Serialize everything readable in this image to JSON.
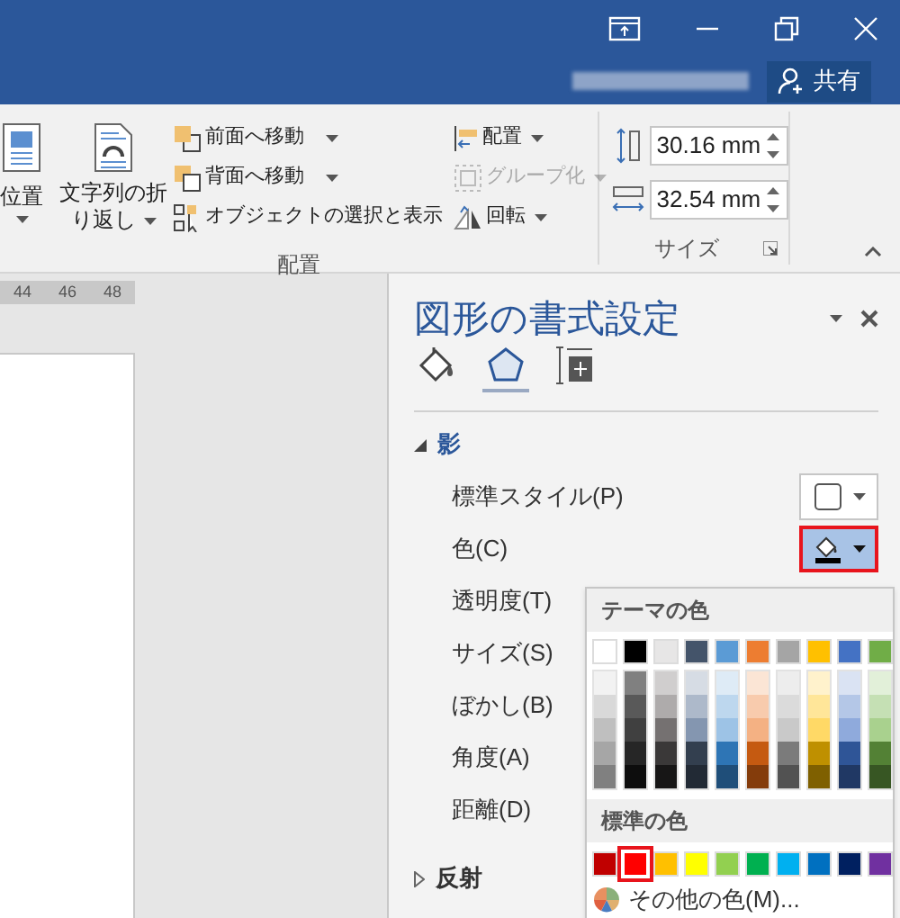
{
  "title_bar": {
    "share_label": "共有"
  },
  "ribbon": {
    "position": {
      "label": "位置"
    },
    "wrap_text": {
      "label": "文字列の折り返し"
    },
    "order_commands": [
      {
        "label": "前面へ移動",
        "dropdown": true,
        "disabled": false
      },
      {
        "label": "背面へ移動",
        "dropdown": true,
        "disabled": false
      },
      {
        "label": "オブジェクトの選択と表示",
        "dropdown": false,
        "disabled": false
      }
    ],
    "align_commands": [
      {
        "label": "配置",
        "dropdown": true,
        "disabled": false
      },
      {
        "label": "グループ化",
        "dropdown": true,
        "disabled": true
      },
      {
        "label": "回転",
        "dropdown": true,
        "disabled": false
      }
    ],
    "arrange_group_label": "配置",
    "size_fields": [
      {
        "value": "30.16 mm"
      },
      {
        "value": "32.54 mm"
      }
    ],
    "size_group_label": "サイズ"
  },
  "ruler": {
    "ticks": [
      "44",
      "46",
      "48"
    ]
  },
  "pane": {
    "title": "図形の書式設定",
    "tabs": [
      {
        "selected": false
      },
      {
        "selected": true
      },
      {
        "selected": false
      }
    ],
    "sections": [
      {
        "label": "影",
        "expanded": true,
        "rows": [
          {
            "kind": "style-picker",
            "label": "標準スタイル(P)"
          },
          {
            "kind": "color-picker",
            "label": "色(C)",
            "open": true
          },
          {
            "kind": "slider",
            "label": "透明度(T)"
          },
          {
            "kind": "slider",
            "label": "サイズ(S)"
          },
          {
            "kind": "slider",
            "label": "ぼかし(B)"
          },
          {
            "kind": "slider",
            "label": "角度(A)"
          },
          {
            "kind": "slider",
            "label": "距離(D)"
          }
        ]
      },
      {
        "label": "反射",
        "expanded": false
      }
    ]
  },
  "color_menu": {
    "theme_heading": "テーマの色",
    "theme_colors": [
      {
        "color": "#ffffff",
        "shades": [
          {
            "color": "#f2f2f2"
          },
          {
            "color": "#d9d9d9"
          },
          {
            "color": "#bfbfbf"
          },
          {
            "color": "#a6a6a6"
          },
          {
            "color": "#808080"
          }
        ]
      },
      {
        "color": "#000000",
        "shades": [
          {
            "color": "#808080"
          },
          {
            "color": "#595959"
          },
          {
            "color": "#404040"
          },
          {
            "color": "#262626"
          },
          {
            "color": "#0d0d0d"
          }
        ]
      },
      {
        "color": "#e7e6e6",
        "shades": [
          {
            "color": "#d0cece"
          },
          {
            "color": "#aeabab"
          },
          {
            "color": "#757171"
          },
          {
            "color": "#3a3838"
          },
          {
            "color": "#171616"
          }
        ]
      },
      {
        "color": "#44546a",
        "shades": [
          {
            "color": "#d6dce4"
          },
          {
            "color": "#adb9ca"
          },
          {
            "color": "#8496b0"
          },
          {
            "color": "#333f4f"
          },
          {
            "color": "#222a35"
          }
        ]
      },
      {
        "color": "#5b9bd5",
        "shades": [
          {
            "color": "#deebf6"
          },
          {
            "color": "#bdd7ee"
          },
          {
            "color": "#9dc3e6"
          },
          {
            "color": "#2e75b5"
          },
          {
            "color": "#1f4e79"
          }
        ]
      },
      {
        "color": "#ed7d31",
        "shades": [
          {
            "color": "#fbe5d5"
          },
          {
            "color": "#f8cbad"
          },
          {
            "color": "#f4b183"
          },
          {
            "color": "#c55a11"
          },
          {
            "color": "#843c0b"
          }
        ]
      },
      {
        "color": "#a5a5a5",
        "shades": [
          {
            "color": "#ededed"
          },
          {
            "color": "#dbdbdb"
          },
          {
            "color": "#c9c9c9"
          },
          {
            "color": "#7b7b7b"
          },
          {
            "color": "#525252"
          }
        ]
      },
      {
        "color": "#ffc000",
        "shades": [
          {
            "color": "#fff2cc"
          },
          {
            "color": "#ffe699"
          },
          {
            "color": "#ffd966"
          },
          {
            "color": "#bf9000"
          },
          {
            "color": "#7f6000"
          }
        ]
      },
      {
        "color": "#4472c4",
        "shades": [
          {
            "color": "#dae3f3"
          },
          {
            "color": "#b4c7e7"
          },
          {
            "color": "#8faadc"
          },
          {
            "color": "#2f5597"
          },
          {
            "color": "#203864"
          }
        ]
      },
      {
        "color": "#70ad47",
        "shades": [
          {
            "color": "#e2f0d9"
          },
          {
            "color": "#c5e0b4"
          },
          {
            "color": "#a9d18e"
          },
          {
            "color": "#538135"
          },
          {
            "color": "#375623"
          }
        ]
      }
    ],
    "standard_heading": "標準の色",
    "standard_colors": [
      {
        "color": "#c00000",
        "selected": false
      },
      {
        "color": "#ff0000",
        "selected": true
      },
      {
        "color": "#ffc000",
        "selected": false
      },
      {
        "color": "#ffff00",
        "selected": false
      },
      {
        "color": "#92d050",
        "selected": false
      },
      {
        "color": "#00b050",
        "selected": false
      },
      {
        "color": "#00b0f0",
        "selected": false
      },
      {
        "color": "#0070c0",
        "selected": false
      },
      {
        "color": "#002060",
        "selected": false
      },
      {
        "color": "#7030a0",
        "selected": false
      }
    ],
    "more_colors": "その他の色(M)..."
  }
}
